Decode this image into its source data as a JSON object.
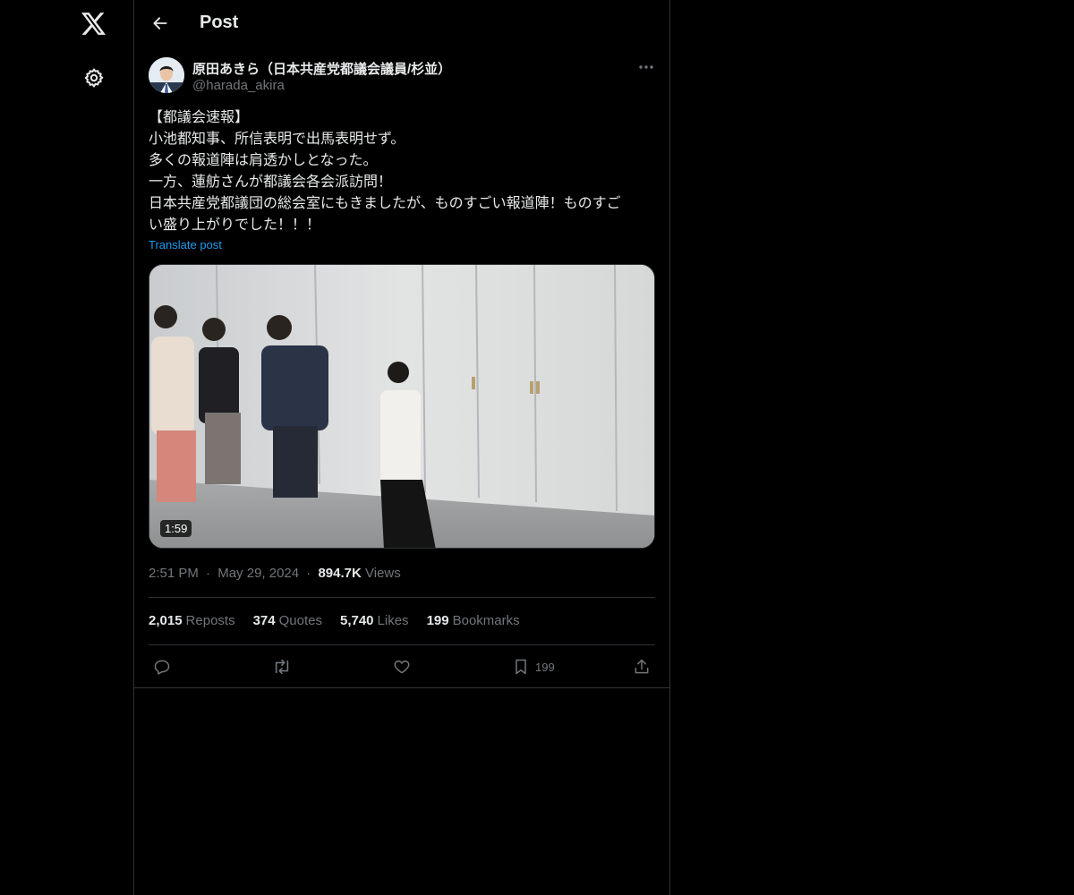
{
  "nav": {
    "logo_icon": "x-logo-icon",
    "settings_icon": "gear-icon"
  },
  "header": {
    "title": "Post"
  },
  "author": {
    "name": "原田あきら（日本共産党都議会議員/杉並）",
    "handle": "@harada_akira"
  },
  "post": {
    "text": "【都議会速報】\n小池都知事、所信表明で出馬表明せず。\n多くの報道陣は肩透かしとなった。\n一方、蓮舫さんが都議会各会派訪問！\n日本共産党都議団の総会室にもきましたが、ものすごい報道陣！ものすご\nい盛り上がりでした！！！",
    "translate_label": "Translate post",
    "video_duration": "1:59"
  },
  "meta": {
    "time": "2:51 PM",
    "date": "May 29, 2024",
    "views_count": "894.7K",
    "views_label": "Views",
    "separator": "·"
  },
  "stats": {
    "reposts_count": "2,015",
    "reposts_label": "Reposts",
    "quotes_count": "374",
    "quotes_label": "Quotes",
    "likes_count": "5,740",
    "likes_label": "Likes",
    "bookmarks_count": "199",
    "bookmarks_label": "Bookmarks"
  },
  "actions": {
    "bookmark_count": "199"
  },
  "colors": {
    "background": "#000000",
    "text": "#e7e9ea",
    "muted": "#71767b",
    "link": "#1d9bf0",
    "border": "#2f3336"
  }
}
